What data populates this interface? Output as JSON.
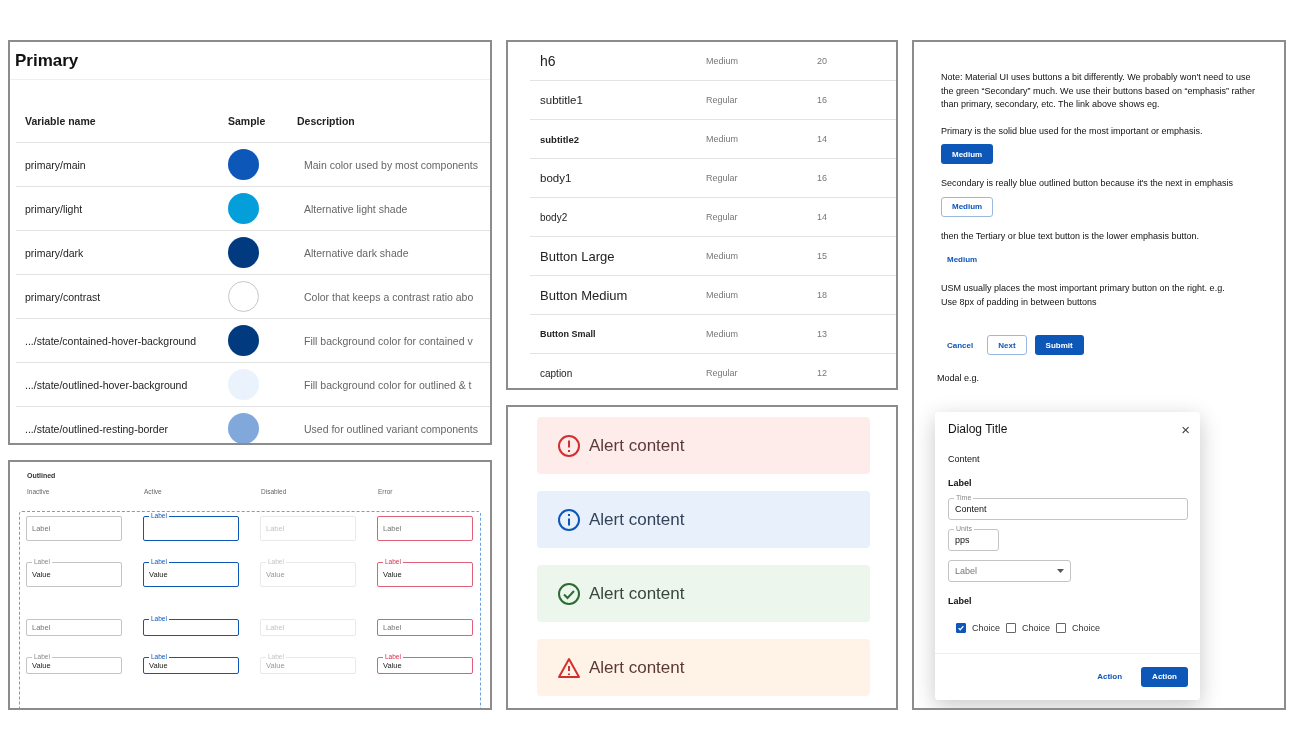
{
  "primary_table": {
    "title": "Primary",
    "columns": [
      "Variable name",
      "Sample",
      "Description"
    ],
    "rows": [
      {
        "name": "primary/main",
        "color": "#0d57b8",
        "description": "Main color used by most components"
      },
      {
        "name": "primary/light",
        "color": "#049fdb",
        "description": "Alternative light shade"
      },
      {
        "name": "primary/dark",
        "color": "#023a80",
        "description": "Alternative dark shade"
      },
      {
        "name": "primary/contrast",
        "color": "#ffffff",
        "description": "Color that keeps a contrast ratio abo"
      },
      {
        "name": ".../state/contained-hover-background",
        "color": "#023a80",
        "description": "Fill background color for contained v"
      },
      {
        "name": ".../state/outlined-hover-background",
        "color": "#eaf2fb",
        "description": "Fill background color for outlined & t"
      },
      {
        "name": ".../state/outlined-resting-border",
        "color": "#80a8da",
        "description": "Used for outlined variant components"
      }
    ]
  },
  "outlined_fields": {
    "title": "Outlined",
    "columns": [
      "Inactive",
      "Active",
      "Disabled",
      "Error"
    ],
    "rows": [
      {
        "kind": "regular",
        "fields": [
          {
            "kind": "inactive",
            "label": "Label",
            "floating": false
          },
          {
            "kind": "active",
            "label": "Label",
            "floating": true
          },
          {
            "kind": "disabled",
            "label": "Label",
            "floating": false
          },
          {
            "kind": "error",
            "label": "Label",
            "floating": false
          }
        ]
      },
      {
        "kind": "regular",
        "fields": [
          {
            "kind": "inactive",
            "label": "Label",
            "floating": true,
            "value": "Value"
          },
          {
            "kind": "active",
            "label": "Label",
            "floating": true,
            "value": "Value"
          },
          {
            "kind": "disabled",
            "label": "Label",
            "floating": true,
            "value": "Value"
          },
          {
            "kind": "error",
            "label": "Label",
            "floating": true,
            "value": "Value"
          }
        ]
      },
      {
        "kind": "dense",
        "fields": [
          {
            "kind": "inactive",
            "label": "Label",
            "floating": false
          },
          {
            "kind": "active",
            "label": "Label",
            "floating": true
          },
          {
            "kind": "disabled",
            "label": "Label",
            "floating": false
          },
          {
            "kind": "error",
            "label": "Label",
            "floating": false
          }
        ]
      },
      {
        "kind": "dense",
        "fields": [
          {
            "kind": "inactive",
            "label": "Label",
            "floating": true,
            "value": "Value"
          },
          {
            "kind": "active",
            "label": "Label",
            "floating": true,
            "value": "Value"
          },
          {
            "kind": "disabled",
            "label": "Label",
            "floating": true,
            "value": "Value"
          },
          {
            "kind": "error",
            "label": "Label",
            "floating": true,
            "value": "Value"
          }
        ]
      }
    ]
  },
  "typography": {
    "rows": [
      {
        "kind": "h6",
        "name": "h6",
        "weight": "Medium",
        "size": "20"
      },
      {
        "kind": "subtitle1",
        "name": "subtitle1",
        "weight": "Regular",
        "size": "16"
      },
      {
        "kind": "subtitle2",
        "name": "subtitle2",
        "weight": "Medium",
        "size": "14"
      },
      {
        "kind": "body1",
        "name": "body1",
        "weight": "Regular",
        "size": "16"
      },
      {
        "kind": "body2",
        "name": "body2",
        "weight": "Regular",
        "size": "14"
      },
      {
        "kind": "button-large",
        "name": "Button Large",
        "weight": "Medium",
        "size": "15"
      },
      {
        "kind": "button-medium",
        "name": "Button Medium",
        "weight": "Medium",
        "size": "18"
      },
      {
        "kind": "button-small",
        "name": "Button Small",
        "weight": "Medium",
        "size": "13"
      },
      {
        "kind": "caption",
        "name": "caption",
        "weight": "Regular",
        "size": "12"
      }
    ]
  },
  "alerts": [
    {
      "kind": "error",
      "text": "Alert content"
    },
    {
      "kind": "info",
      "text": "Alert content"
    },
    {
      "kind": "success",
      "text": "Alert content"
    },
    {
      "kind": "warning",
      "text": "Alert content"
    }
  ],
  "button_notes": {
    "blocks": [
      {
        "kind": "paragraph",
        "text": "Note: Material UI uses buttons a bit differently. We probably won't need to use the green “Secondary” much. We use their buttons based on “emphasis” rather than primary, secondary, etc. The link above shows eg."
      },
      {
        "kind": "paragraph",
        "text": "Primary is the solid blue used for the most important or emphasis."
      },
      {
        "kind": "buttons",
        "buttons": [
          {
            "kind": "contained",
            "label": "Medium"
          }
        ]
      },
      {
        "kind": "paragraph",
        "text": "Secondary is really blue outlined button because it's the next in emphasis"
      },
      {
        "kind": "buttons",
        "buttons": [
          {
            "kind": "outlined",
            "label": "Medium"
          }
        ]
      },
      {
        "kind": "paragraph",
        "text": "then the Tertiary or blue text button is the lower emphasis button."
      },
      {
        "kind": "buttons",
        "buttons": [
          {
            "kind": "text",
            "label": "Medium"
          }
        ]
      },
      {
        "kind": "paragraph",
        "text": "USM usually places the most important primary button on the right. e.g.\nUse 8px of padding in between buttons"
      },
      {
        "kind": "buttons",
        "buttons": [
          {
            "kind": "text",
            "label": "Cancel"
          },
          {
            "kind": "outlined",
            "label": "Next"
          },
          {
            "kind": "contained",
            "label": "Submit"
          }
        ]
      },
      {
        "kind": "caption",
        "text": "Modal e.g."
      }
    ]
  },
  "modal": {
    "title": "Dialog Title",
    "close": "×",
    "body": "Content",
    "group_label": "Label",
    "fields": [
      {
        "kind": "text",
        "label": "Time",
        "value": "Content"
      },
      {
        "kind": "short",
        "label": "Units",
        "value": "pps"
      },
      {
        "kind": "select",
        "placeholder": "Label"
      }
    ],
    "choices_label": "Label",
    "choices": [
      {
        "label": "Choice",
        "checked": true
      },
      {
        "label": "Choice",
        "checked": false
      },
      {
        "label": "Choice",
        "checked": false
      }
    ],
    "actions": [
      {
        "kind": "text",
        "label": "Action"
      },
      {
        "kind": "contained",
        "label": "Action"
      }
    ]
  }
}
